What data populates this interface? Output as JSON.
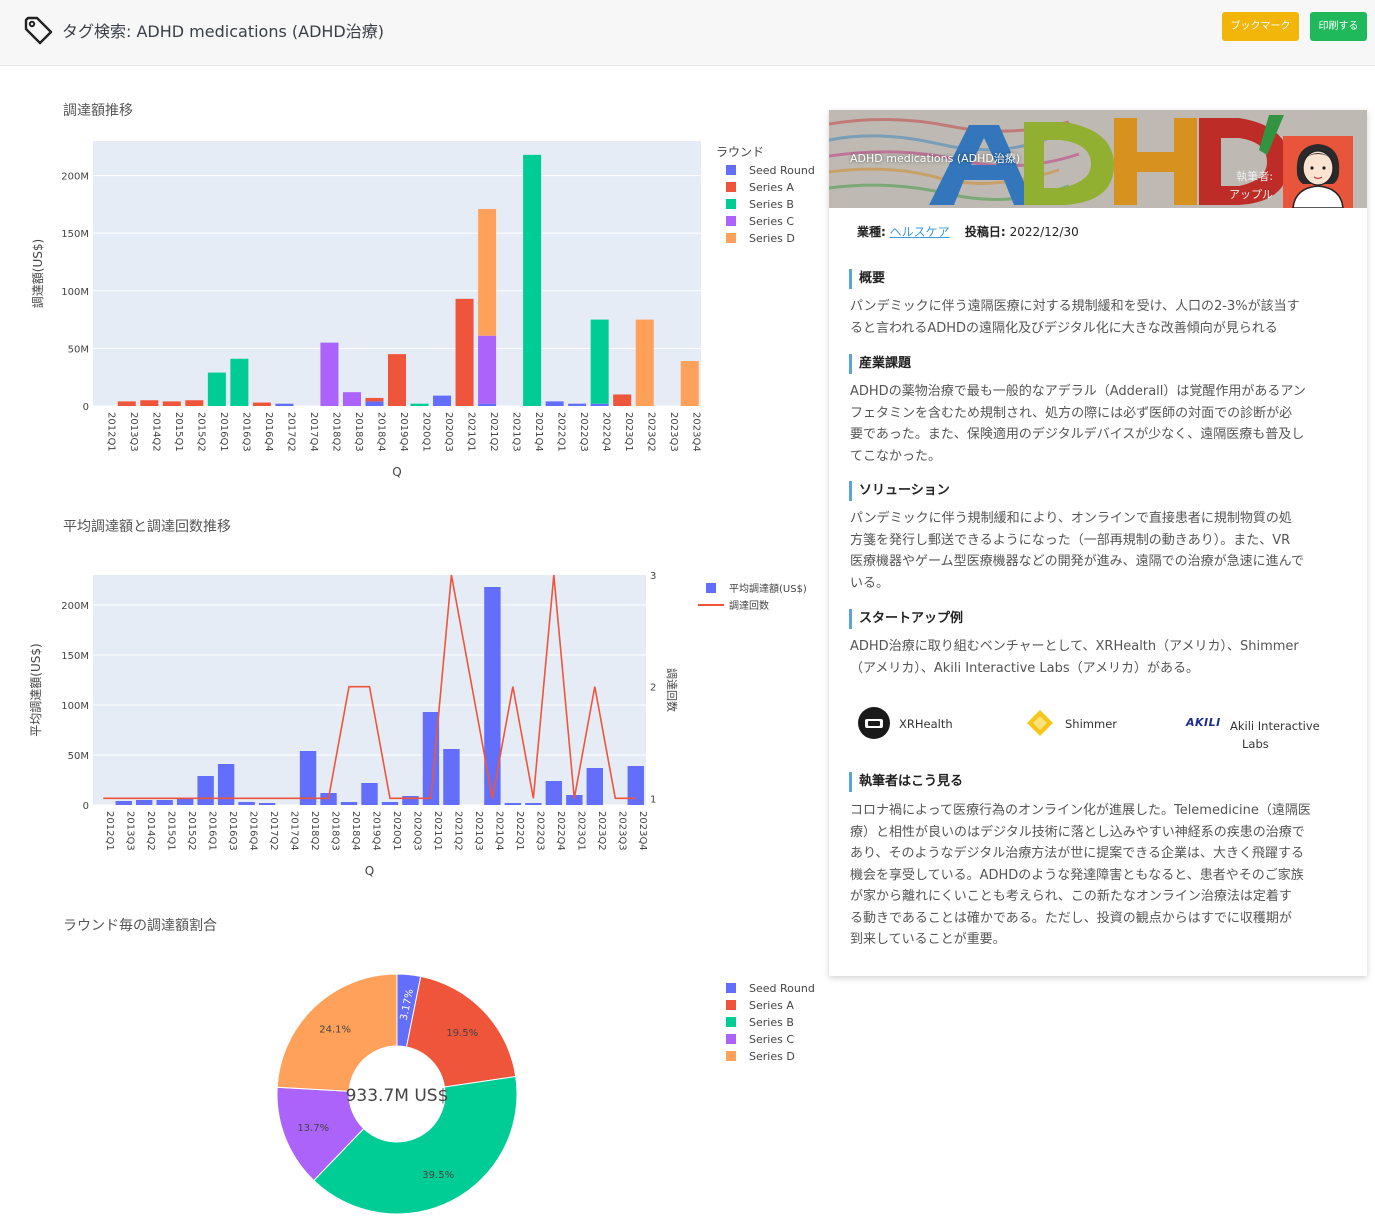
{
  "header": {
    "title": "タグ検索: ADHD medications (ADHD治療)",
    "bookmark_label": "ブックマーク",
    "print_label": "印刷する"
  },
  "colors": {
    "seed": "#636efa",
    "seriesA": "#ef553b",
    "seriesB": "#00cc96",
    "seriesC": "#ab63fa",
    "seriesD": "#ffa15a",
    "plot_bg": "#e5ecf6",
    "bookmark": "#f2b50a",
    "print": "#1fb85a"
  },
  "sections": {
    "funding_title": "調達額推移",
    "average_title": "平均調達額と調達回数推移",
    "share_title": "ラウンド毎の調達額割合"
  },
  "chart_data": [
    {
      "type": "bar",
      "stacked": true,
      "title": "調達額推移",
      "xlabel": "Q",
      "ylabel": "調達額(US$)",
      "ylim": [
        0,
        230
      ],
      "yticks": [
        "0",
        "50M",
        "100M",
        "150M",
        "200M"
      ],
      "legend_title": "ラウンド",
      "legend_position": "right",
      "categories": [
        "2012Q1",
        "2013Q3",
        "2014Q2",
        "2015Q1",
        "2015Q2",
        "2016Q1",
        "2016Q3",
        "2016Q4",
        "2017Q2",
        "2017Q4",
        "2018Q2",
        "2018Q3",
        "2018Q4",
        "2019Q4",
        "2020Q1",
        "2020Q3",
        "2021Q1",
        "2021Q2",
        "2021Q3",
        "2021Q4",
        "2022Q1",
        "2022Q3",
        "2022Q4",
        "2023Q1",
        "2023Q2",
        "2023Q3",
        "2023Q4"
      ],
      "series": [
        {
          "name": "Seed Round",
          "values": [
            0,
            0,
            0,
            0,
            0,
            0,
            0,
            0,
            2,
            0,
            0,
            0,
            4,
            0,
            0,
            9,
            0,
            2,
            0,
            0,
            4,
            2,
            2,
            0,
            0,
            0,
            0
          ]
        },
        {
          "name": "Series A",
          "values": [
            0,
            4,
            5,
            4,
            5,
            0,
            0,
            3,
            0,
            0,
            0,
            0,
            3,
            45,
            0,
            0,
            93,
            0,
            0,
            0,
            0,
            0,
            0,
            10,
            0,
            0,
            0
          ]
        },
        {
          "name": "Series B",
          "values": [
            0,
            0,
            0,
            0,
            0,
            29,
            41,
            0,
            0,
            0,
            0,
            0,
            0,
            0,
            2,
            0,
            0,
            0,
            0,
            218,
            0,
            0,
            73,
            0,
            0,
            0,
            0
          ]
        },
        {
          "name": "Series C",
          "values": [
            0,
            0,
            0,
            0,
            0,
            0,
            0,
            0,
            0,
            0,
            55,
            12,
            0,
            0,
            0,
            0,
            0,
            59,
            0,
            0,
            0,
            0,
            0,
            0,
            0,
            0,
            0
          ]
        },
        {
          "name": "Series D",
          "values": [
            0,
            0,
            0,
            0,
            0,
            0,
            0,
            0,
            0,
            0,
            0,
            0,
            0,
            0,
            0,
            0,
            0,
            110,
            0,
            0,
            0,
            0,
            0,
            0,
            75,
            0,
            39
          ]
        }
      ]
    },
    {
      "type": "bar",
      "title": "平均調達額と調達回数推移",
      "xlabel": "Q",
      "ylabel": "平均調達額(US$)",
      "y2label": "調達回数",
      "ylim": [
        0,
        230
      ],
      "y2lim": [
        0.94,
        3.0
      ],
      "yticks": [
        "0",
        "50M",
        "100M",
        "150M",
        "200M"
      ],
      "y2ticks": [
        "1",
        "2",
        "3"
      ],
      "legend_position": "right",
      "categories": [
        "2012Q1",
        "2013Q3",
        "2014Q2",
        "2015Q1",
        "2015Q2",
        "2016Q1",
        "2016Q3",
        "2016Q4",
        "2017Q2",
        "2017Q4",
        "2018Q2",
        "2018Q3",
        "2018Q4",
        "2019Q4",
        "2020Q1",
        "2020Q3",
        "2021Q1",
        "2021Q2",
        "2021Q3",
        "2021Q4",
        "2022Q1",
        "2022Q3",
        "2022Q4",
        "2023Q1",
        "2023Q2",
        "2023Q3",
        "2023Q4"
      ],
      "series": [
        {
          "name": "平均調達額(US$)",
          "type": "bar",
          "values": [
            0,
            4,
            5,
            5,
            6,
            29,
            41,
            3,
            2,
            0,
            54,
            12,
            3,
            22,
            3,
            9,
            93,
            56,
            0,
            218,
            2,
            2,
            24,
            10,
            37,
            0,
            39
          ]
        },
        {
          "name": "調達回数",
          "type": "line",
          "values": [
            1,
            1,
            1,
            1,
            1,
            1,
            1,
            1,
            1,
            1,
            1,
            1,
            2,
            2,
            1,
            1,
            1,
            3,
            2,
            1,
            2,
            1,
            3,
            1,
            2,
            1,
            1
          ]
        }
      ]
    },
    {
      "type": "pie",
      "title": "ラウンド毎の調達額割合",
      "center_label": "933.7M US$",
      "legend_position": "right",
      "categories": [
        "Seed Round",
        "Series A",
        "Series B",
        "Series C",
        "Series D"
      ],
      "values": [
        3.17,
        19.5,
        39.5,
        13.7,
        24.1
      ],
      "labels": [
        "3.17%",
        "19.5%",
        "39.5%",
        "13.7%",
        "24.1%"
      ]
    }
  ],
  "card": {
    "hero_title": "ADHD medications (ADHD治療)",
    "hero_author_label_1": "執筆者:",
    "hero_author_label_2": "アップル",
    "meta_industry_label": "業種:",
    "meta_industry_value": "ヘルスケア",
    "meta_date_label": "投稿日:",
    "meta_date_value": "2022/12/30",
    "sections": [
      {
        "heading": "概要",
        "lines": [
          "パンデミックに伴う遠隔医療に対する規制緩和を受け、人口の2-3%が該当す",
          "ると言われるADHDの遠隔化及びデジタル化に大きな改善傾向が見られる"
        ]
      },
      {
        "heading": "産業課題",
        "lines": [
          "ADHDの薬物治療で最も一般的なアデラル（Adderall）は覚醒作用があるアン",
          "フェタミンを含むため規制され、処方の際には必ず医師の対面での診断が必",
          "要であった。また、保険適用のデジタルデバイスが少なく、遠隔医療も普及し",
          "てこなかった。"
        ]
      },
      {
        "heading": "ソリューション",
        "lines": [
          "パンデミックに伴う規制緩和により、オンラインで直接患者に規制物質の処",
          "方箋を発行し郵送できるようになった（一部再規制の動きあり）。また、VR",
          "医療機器やゲーム型医療機器などの開発が進み、遠隔での治療が急速に進んで",
          "いる。"
        ]
      },
      {
        "heading": "スタートアップ例",
        "lines": [
          "ADHD治療に取り組むベンチャーとして、XRHealth（アメリカ）、Shimmer",
          "（アメリカ）、Akili Interactive Labs（アメリカ）がある。"
        ]
      },
      {
        "heading": "執筆者はこう見る",
        "lines": [
          "コロナ禍によって医療行為のオンライン化が進展した。Telemedicine（遠隔医",
          "療）と相性が良いのはデジタル技術に落とし込みやすい神経系の疾患の治療で",
          "あり、そのようなデジタル治療方法が世に提案できる企業は、大きく飛躍する",
          "機会を享受している。ADHDのような発達障害ともなると、患者やそのご家族",
          "が家から離れにくいことも考えられ、この新たなオンライン治療法は定着す",
          "る動きであることは確かである。ただし、投資の観点からはすでに収穫期が",
          "到来していることが重要。"
        ]
      }
    ],
    "startups": [
      {
        "name_1": "XRHealth",
        "name_2": "",
        "logo": "xrhealth-logo"
      },
      {
        "name_1": "Shimmer",
        "name_2": "",
        "logo": "shimmer-logo"
      },
      {
        "name_1": "Akili Interactive",
        "name_2": "Labs",
        "logo": "akili-logo",
        "logo_text": "AKILI"
      }
    ]
  }
}
